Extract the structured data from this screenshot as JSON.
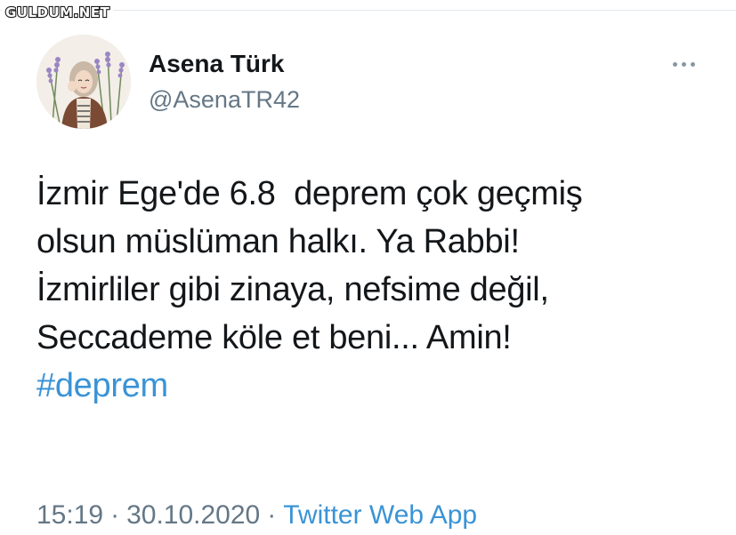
{
  "watermark": {
    "text": "GULDUM.NET"
  },
  "author": {
    "display_name": "Asena Türk",
    "handle": "@AsenaTR42",
    "avatar_icon": "profile-photo"
  },
  "tweet": {
    "lines": [
      "İzmir Ege'de 6.8  deprem çok geçmiş",
      "olsun müslüman halkı. Ya Rabbi!",
      "İzmirliler gibi zinaya, nefsime değil,",
      "Seccademe köle et beni... Amin!"
    ],
    "hashtag": "#deprem"
  },
  "meta": {
    "time": "15:19",
    "separator": "·",
    "date": "30.10.2020",
    "source": "Twitter Web App"
  },
  "more_button": {
    "icon": "more-horizontal-icon"
  },
  "colors": {
    "text": "#14171a",
    "secondary": "#657786",
    "link": "#3a93d6",
    "divider": "#e3e8ec"
  }
}
